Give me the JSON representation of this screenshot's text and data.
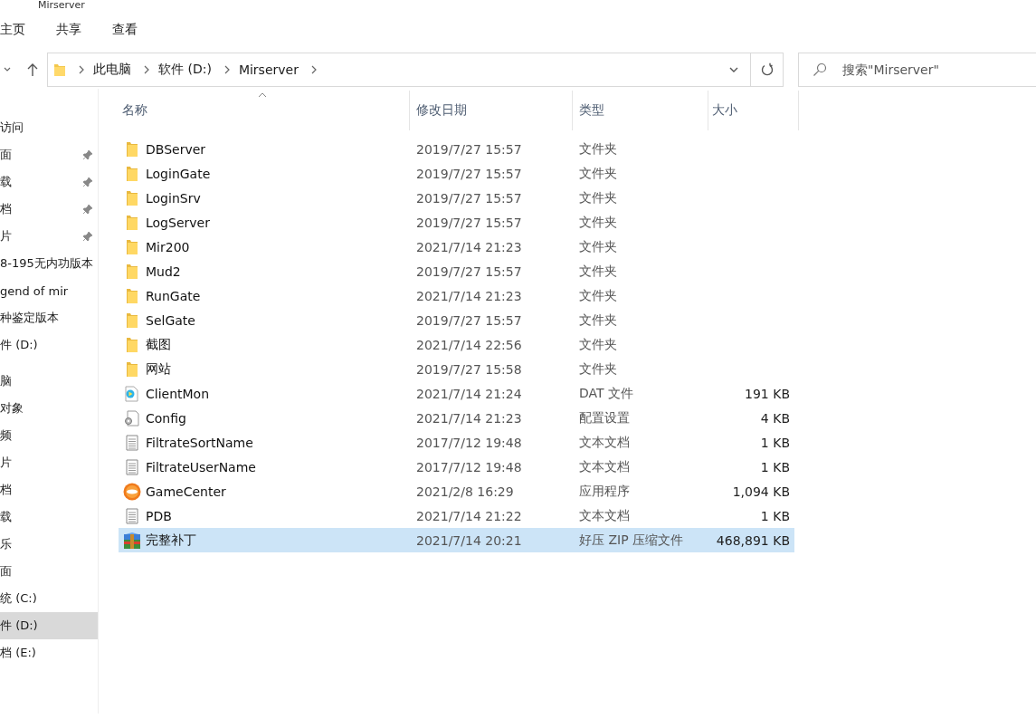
{
  "window": {
    "title": "Mirserver"
  },
  "ribbon_tabs": [
    {
      "label": "主页",
      "selected": false
    },
    {
      "label": "共享",
      "selected": false
    },
    {
      "label": "查看",
      "selected": false
    }
  ],
  "address_bar": {
    "path": [
      "此电脑",
      "软件 (D:)",
      "Mirserver"
    ]
  },
  "search": {
    "placeholder": "搜索\"Mirserver\""
  },
  "sidebar": {
    "groups": [
      {
        "items": [
          {
            "label": "访问",
            "pinned": false,
            "selected": false
          },
          {
            "label": "面",
            "pinned": true,
            "selected": false
          },
          {
            "label": "载",
            "pinned": true,
            "selected": false
          },
          {
            "label": "档",
            "pinned": true,
            "selected": false
          },
          {
            "label": "片",
            "pinned": true,
            "selected": false
          },
          {
            "label": "8-195无内功版本",
            "pinned": false,
            "selected": false
          },
          {
            "label": "gend of mir",
            "pinned": false,
            "selected": false
          },
          {
            "label": "种鉴定版本",
            "pinned": false,
            "selected": false
          },
          {
            "label": "件 (D:)",
            "pinned": false,
            "selected": false
          }
        ]
      },
      {
        "items": [
          {
            "label": "脑",
            "pinned": false,
            "selected": false
          },
          {
            "label": "对象",
            "pinned": false,
            "selected": false
          },
          {
            "label": "频",
            "pinned": false,
            "selected": false
          },
          {
            "label": "片",
            "pinned": false,
            "selected": false
          },
          {
            "label": "档",
            "pinned": false,
            "selected": false
          },
          {
            "label": "载",
            "pinned": false,
            "selected": false
          },
          {
            "label": "乐",
            "pinned": false,
            "selected": false
          },
          {
            "label": "面",
            "pinned": false,
            "selected": false
          },
          {
            "label": "统 (C:)",
            "pinned": false,
            "selected": false
          },
          {
            "label": "件 (D:)",
            "pinned": false,
            "selected": true
          },
          {
            "label": "档 (E:)",
            "pinned": false,
            "selected": false
          }
        ]
      }
    ]
  },
  "table": {
    "columns": [
      "名称",
      "修改日期",
      "类型",
      "大小"
    ],
    "rows": [
      {
        "kind": "folder",
        "name": "DBServer",
        "date": "2019/7/27 15:57",
        "type": "文件夹",
        "selected": false
      },
      {
        "kind": "folder",
        "name": "LoginGate",
        "date": "2019/7/27 15:57",
        "type": "文件夹",
        "selected": false
      },
      {
        "kind": "folder",
        "name": "LoginSrv",
        "date": "2019/7/27 15:57",
        "type": "文件夹",
        "selected": false
      },
      {
        "kind": "folder",
        "name": "LogServer",
        "date": "2019/7/27 15:57",
        "type": "文件夹",
        "selected": false
      },
      {
        "kind": "folder",
        "name": "Mir200",
        "date": "2021/7/14 21:23",
        "type": "文件夹",
        "selected": false
      },
      {
        "kind": "folder",
        "name": "Mud2",
        "date": "2019/7/27 15:57",
        "type": "文件夹",
        "selected": false
      },
      {
        "kind": "folder",
        "name": "RunGate",
        "date": "2021/7/14 21:23",
        "type": "文件夹",
        "selected": false
      },
      {
        "kind": "folder",
        "name": "SelGate",
        "date": "2019/7/27 15:57",
        "type": "文件夹",
        "selected": false
      },
      {
        "kind": "folder",
        "name": "截图",
        "date": "2021/7/14 22:56",
        "type": "文件夹",
        "selected": false
      },
      {
        "kind": "folder",
        "name": "网站",
        "date": "2019/7/27 15:58",
        "type": "文件夹",
        "selected": false
      },
      {
        "kind": "video",
        "name": "ClientMon",
        "date": "2021/7/14 21:24",
        "type": "DAT 文件",
        "size": "191 KB",
        "selected": false
      },
      {
        "kind": "config",
        "name": "Config",
        "date": "2021/7/14 21:23",
        "type": "配置设置",
        "size": "4 KB",
        "selected": false
      },
      {
        "kind": "text",
        "name": "FiltrateSortName",
        "date": "2017/7/12 19:48",
        "type": "文本文档",
        "size": "1 KB",
        "selected": false
      },
      {
        "kind": "text",
        "name": "FiltrateUserName",
        "date": "2017/7/12 19:48",
        "type": "文本文档",
        "size": "1 KB",
        "selected": false
      },
      {
        "kind": "app",
        "name": "GameCenter",
        "date": "2021/2/8 16:29",
        "type": "应用程序",
        "size": "1,094 KB",
        "selected": false
      },
      {
        "kind": "text",
        "name": "PDB",
        "date": "2021/7/14 21:22",
        "type": "文本文档",
        "size": "1 KB",
        "selected": false
      },
      {
        "kind": "archive",
        "name": "完整补丁",
        "date": "2021/7/14 20:21",
        "type": "好压 ZIP 压缩文件",
        "size": "468,891 KB",
        "selected": true
      }
    ]
  }
}
